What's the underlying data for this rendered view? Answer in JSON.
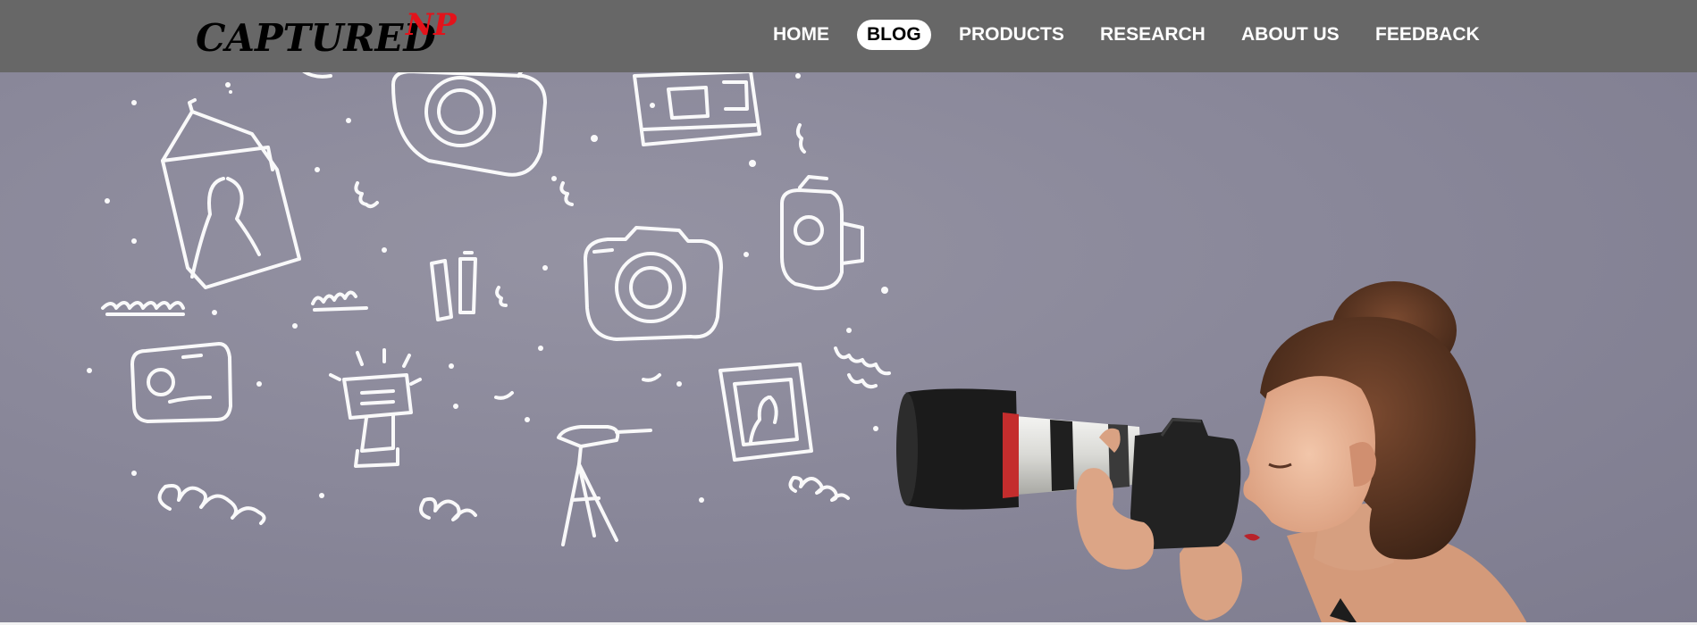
{
  "logo": {
    "main": "CAPTURED",
    "superscript": "NP"
  },
  "nav": {
    "items": [
      {
        "label": "HOME",
        "active": false
      },
      {
        "label": "BLOG",
        "active": true
      },
      {
        "label": "PRODUCTS",
        "active": false
      },
      {
        "label": "RESEARCH",
        "active": false
      },
      {
        "label": "ABOUT US",
        "active": false
      },
      {
        "label": "FEEDBACK",
        "active": false
      }
    ]
  },
  "hero": {
    "image": "photographer-woman-with-camera-and-chalk-doodles",
    "doodle_icons": [
      "portrait-frame-icon",
      "camera-icon",
      "film-strip-icon",
      "camcorder-icon",
      "compact-camera-icon",
      "flash-icon",
      "tripod-icon",
      "picture-frame-icon",
      "batteries-icon"
    ]
  },
  "colors": {
    "header_bg": "#676767",
    "wall": "#8a889a",
    "logo_text": "#000000",
    "logo_accent": "#e3131b",
    "nav_text": "#ffffff",
    "nav_active_bg": "#ffffff",
    "nav_active_text": "#000000"
  }
}
